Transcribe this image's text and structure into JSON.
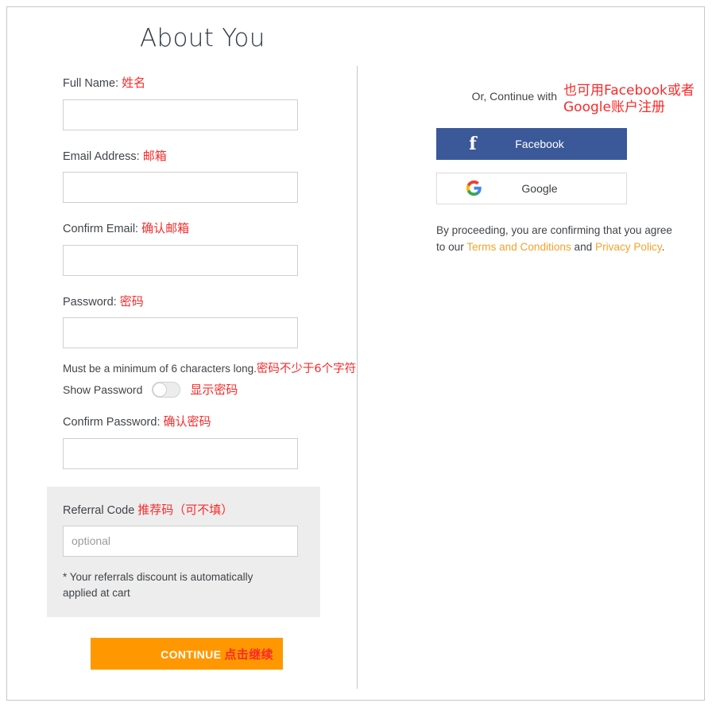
{
  "page": {
    "title": "About You"
  },
  "form": {
    "full_name": {
      "label": "Full Name:",
      "annotation": "姓名",
      "value": "",
      "placeholder": ""
    },
    "email": {
      "label": "Email Address:",
      "annotation": "邮箱",
      "value": "",
      "placeholder": ""
    },
    "confirm_email": {
      "label": "Confirm Email:",
      "annotation": "确认邮箱",
      "value": "",
      "placeholder": ""
    },
    "password": {
      "label": "Password:",
      "annotation": "密码",
      "value": "",
      "placeholder": "",
      "hint": "Must be a minimum of 6 characters long.",
      "hint_annotation": "密码不少于6个字符"
    },
    "show_password": {
      "label": "Show Password",
      "annotation": "显示密码",
      "state": "off"
    },
    "confirm_password": {
      "label": "Confirm Password:",
      "annotation": "确认密码",
      "value": "",
      "placeholder": ""
    },
    "referral": {
      "label": "Referral Code",
      "annotation": "推荐码（可不填）",
      "value": "",
      "placeholder": "optional",
      "note": "* Your referrals discount is automatically applied at cart"
    },
    "continue_button": {
      "label": "CONTINUE",
      "annotation": "点击继续"
    }
  },
  "social": {
    "or_text": "Or, Continue with",
    "or_annotation": "也可用Facebook或者Google账户注册",
    "facebook": {
      "label": "Facebook",
      "icon": "facebook-icon",
      "color": "#3b5998"
    },
    "google": {
      "label": "Google",
      "icon": "google-icon"
    },
    "terms": {
      "prefix": "By proceeding, you are confirming that you agree to our ",
      "terms_link": "Terms and Conditions",
      "middle": " and ",
      "privacy_link": "Privacy Policy",
      "suffix": "."
    }
  },
  "colors": {
    "accent_orange": "#ff9800",
    "link_orange": "#f5a22a",
    "annotation_red": "#fa2a2a",
    "facebook_blue": "#3b5998"
  }
}
